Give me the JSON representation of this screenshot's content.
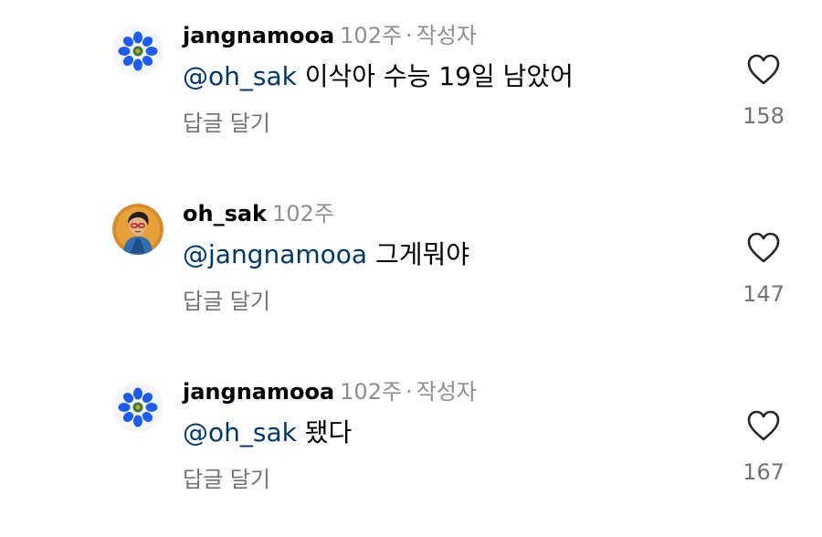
{
  "comments": [
    {
      "username": "jangnamooa",
      "time": "102주",
      "separator": "·",
      "badge": "작성자",
      "mention": "@oh_sak",
      "text": "이삭아 수능 19일 남았어",
      "reply_label": "답글 달기",
      "likes": "158",
      "avatar_icon": "blue-flower-avatar"
    },
    {
      "username": "oh_sak",
      "time": "102주",
      "mention": "@jangnamooa",
      "text": "그게뭐야",
      "reply_label": "답글 달기",
      "likes": "147",
      "avatar_icon": "portrait-illustration-avatar"
    },
    {
      "username": "jangnamooa",
      "time": "102주",
      "separator": "·",
      "badge": "작성자",
      "mention": "@oh_sak",
      "text": "됐다",
      "reply_label": "답글 달기",
      "likes": "167",
      "avatar_icon": "blue-flower-avatar"
    }
  ],
  "colors": {
    "mention": "#00376b",
    "meta": "#8e8e8e",
    "secondary": "#737373",
    "flower_petal": "#1e5cf0",
    "flower_center": "#3a7a3a"
  }
}
